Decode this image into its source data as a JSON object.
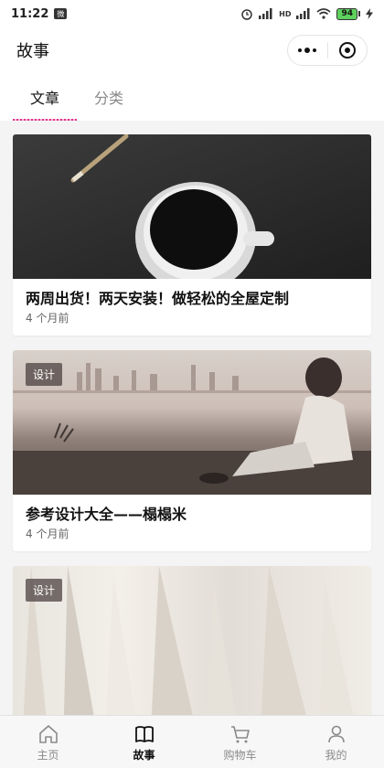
{
  "status_bar": {
    "time": "11:22",
    "notification_badge": "微",
    "network_label": "HD",
    "battery": "94"
  },
  "nav": {
    "title": "故事"
  },
  "tabs": [
    {
      "label": "文章",
      "active": true
    },
    {
      "label": "分类",
      "active": false
    }
  ],
  "articles": [
    {
      "title": "两周出货！两天安装！做轻松的全屋定制",
      "time": "4 个月前",
      "tag": ""
    },
    {
      "title": "参考设计大全——榻榻米",
      "time": "4 个月前",
      "tag": "设计"
    },
    {
      "title": "",
      "time": "",
      "tag": "设计"
    }
  ],
  "tab_bar": [
    {
      "label": "主页",
      "icon": "home-icon",
      "active": false
    },
    {
      "label": "故事",
      "icon": "book-icon",
      "active": true
    },
    {
      "label": "购物车",
      "icon": "cart-icon",
      "active": false
    },
    {
      "label": "我的",
      "icon": "user-icon",
      "active": false
    }
  ],
  "colors": {
    "tab_underline": "#e0338a",
    "battery_fill": "#5ed15e"
  }
}
